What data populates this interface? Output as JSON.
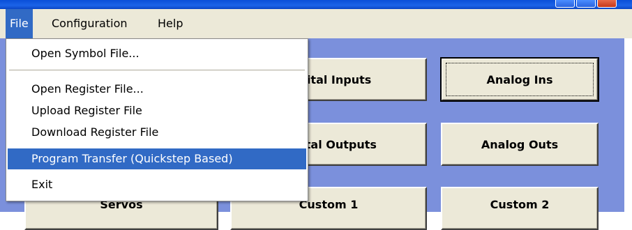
{
  "menubar": {
    "items": [
      "File",
      "Configuration",
      "Help"
    ],
    "active": "File"
  },
  "file_menu": {
    "items": [
      "Open Symbol File...",
      "Open Register File...",
      "Upload Register File",
      "Download Register File",
      "Program Transfer (Quickstep Based)",
      "Exit"
    ],
    "highlighted": "Program Transfer (Quickstep Based)"
  },
  "buttons": {
    "digital_inputs": "Digital Inputs",
    "analog_ins": "Analog Ins",
    "digital_outputs": "Digital Outputs",
    "analog_outs": "Analog Outs",
    "servos": "Servos",
    "custom_1": "Custom 1",
    "custom_2": "Custom 2"
  },
  "colors": {
    "client_background": "#7b90dc",
    "menu_highlight": "#316ac5",
    "button_face": "#ece9d8"
  }
}
